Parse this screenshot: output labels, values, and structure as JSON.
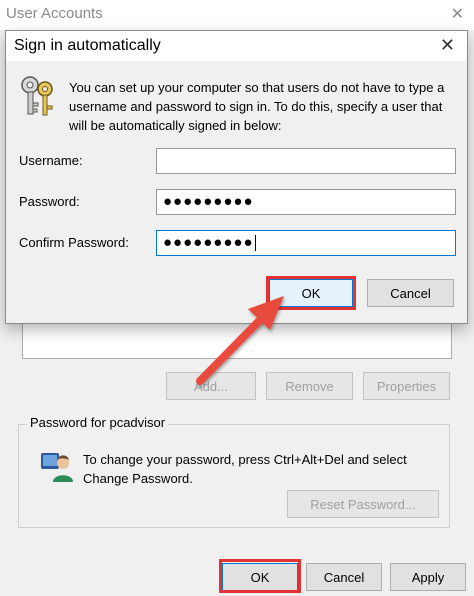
{
  "background_window": {
    "title": "User Accounts",
    "close_glyph": "✕",
    "buttons": {
      "add": "Add...",
      "remove": "Remove",
      "properties": "Properties"
    },
    "password_group": {
      "label": "Password for pcadvisor",
      "text": "To change your password, press Ctrl+Alt+Del and select Change Password.",
      "reset_button": "Reset Password..."
    },
    "footer": {
      "ok": "OK",
      "cancel": "Cancel",
      "apply": "Apply"
    }
  },
  "dialog": {
    "title": "Sign in automatically",
    "close_glyph": "✕",
    "description": "You can set up your computer so that users do not have to type a username and password to sign in. To do this, specify a user that will be automatically signed in below:",
    "fields": {
      "username_label": "Username:",
      "username_value": "",
      "password_label": "Password:",
      "password_value": "●●●●●●●●●",
      "confirm_label": "Confirm Password:",
      "confirm_value": "●●●●●●●●●"
    },
    "buttons": {
      "ok": "OK",
      "cancel": "Cancel"
    }
  },
  "annotations": {
    "highlight_color": "#e23232",
    "arrow_color": "#e84c3d"
  },
  "icons": [
    "keys-icon",
    "users-icon",
    "close-icon"
  ]
}
